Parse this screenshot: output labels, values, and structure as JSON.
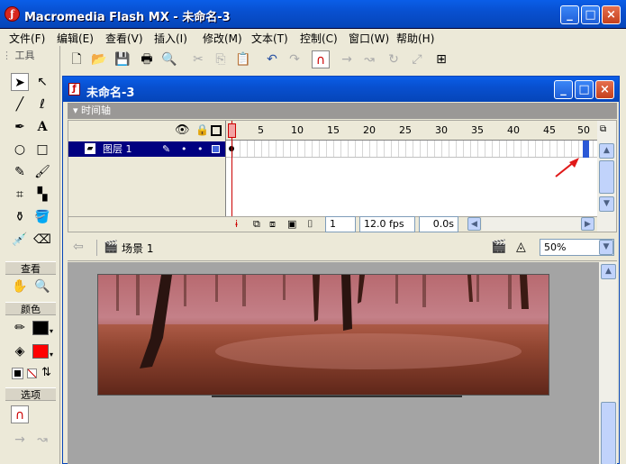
{
  "app": {
    "title": "Macromedia Flash MX - 未命名-3",
    "logo_glyph": "ƒ"
  },
  "window_buttons": [
    "_",
    "□",
    "×"
  ],
  "menu": [
    "文件(F)",
    "编辑(E)",
    "查看(V)",
    "插入(I)",
    "修改(M)",
    "文本(T)",
    "控制(C)",
    "窗口(W)",
    "帮助(H)"
  ],
  "toolbox": {
    "title": "工具",
    "sections": {
      "view": "查看",
      "colors": "颜色",
      "options": "选项"
    }
  },
  "document": {
    "title": "未命名-3",
    "timeline_label": "▾ 时间轴",
    "ruler_numbers": [
      "1",
      "5",
      "10",
      "15",
      "20",
      "25",
      "30",
      "35",
      "40",
      "45",
      "50"
    ],
    "layer_name": "图层 1",
    "footer": {
      "frame": "1",
      "fps": "12.0 fps",
      "time": "0.0s"
    },
    "scene_name": "场景 1",
    "zoom": "50%"
  },
  "colors": {
    "stroke": "#000000",
    "fill": "#ff0000",
    "titlebar": "#0850d0"
  }
}
